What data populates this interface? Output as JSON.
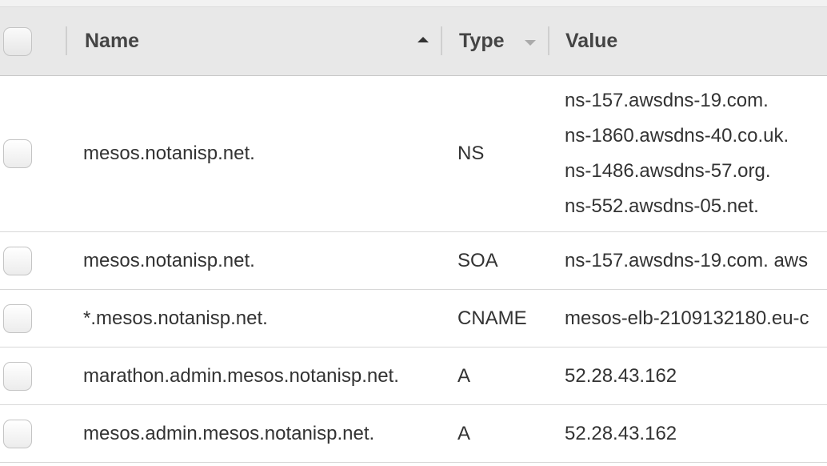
{
  "table": {
    "columns": {
      "name": "Name",
      "type": "Type",
      "value": "Value"
    },
    "rows": [
      {
        "name": "mesos.notanisp.net.",
        "type": "NS",
        "values": [
          "ns-157.awsdns-19.com.",
          "ns-1860.awsdns-40.co.uk.",
          "ns-1486.awsdns-57.org.",
          "ns-552.awsdns-05.net."
        ]
      },
      {
        "name": "mesos.notanisp.net.",
        "type": "SOA",
        "values": [
          "ns-157.awsdns-19.com. aws"
        ]
      },
      {
        "name": "*.mesos.notanisp.net.",
        "type": "CNAME",
        "values": [
          "mesos-elb-2109132180.eu-c"
        ]
      },
      {
        "name": "marathon.admin.mesos.notanisp.net.",
        "type": "A",
        "values": [
          "52.28.43.162"
        ]
      },
      {
        "name": "mesos.admin.mesos.notanisp.net.",
        "type": "A",
        "values": [
          "52.28.43.162"
        ]
      }
    ]
  }
}
